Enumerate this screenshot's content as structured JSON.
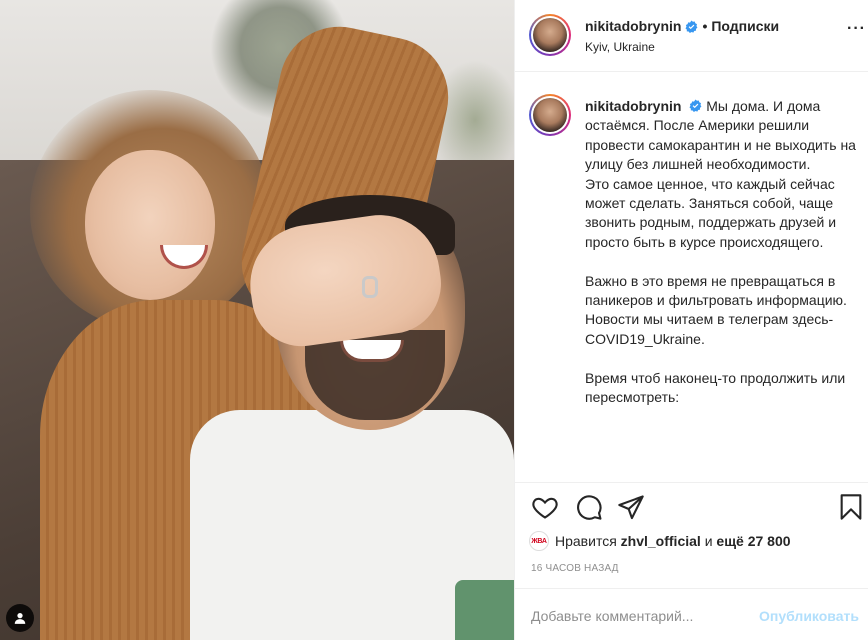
{
  "post": {
    "username": "nikitadobrynin",
    "follow_dot": "•",
    "follow_label": "Подписки",
    "location": "Kyiv, Ukraine",
    "more_label": "···"
  },
  "caption": {
    "username": "nikitadobrynin",
    "paragraphs": [
      "Мы дома. И дома остаёмся. После Америки решили провести самокарантин и не выходить на улицу без лишней необходимости.",
      "Это самое ценное, что каждый сейчас может сделать. Заняться собой, чаще звонить родным, поддержать друзей и просто быть в курсе происходящего.",
      "",
      "Важно в это время не превращаться в паникеров и фильтровать информацию.",
      "Новости мы читаем в телеграм здесь- COVID19_Ukraine.",
      "",
      "Время чтоб наконец-то продолжить или пересмотреть:"
    ]
  },
  "likes": {
    "avatar_text": "ЖВА",
    "prefix": "Нравится",
    "user": "zhvl_official",
    "and": "и",
    "more": "ещё 27 800"
  },
  "time_ago": "16 часов назад",
  "comment": {
    "placeholder": "Добавьте комментарий...",
    "publish_label": "Опубликовать"
  },
  "icons": {
    "like": "heart-icon",
    "comment": "comment-icon",
    "share": "share-icon",
    "save": "bookmark-icon",
    "verified": "verified-badge-icon",
    "user_tags": "user-tag-icon"
  },
  "colors": {
    "verified_blue": "#3897f0",
    "publish_disabled": "#b2dffc",
    "muted_text": "#8e8e8e"
  }
}
